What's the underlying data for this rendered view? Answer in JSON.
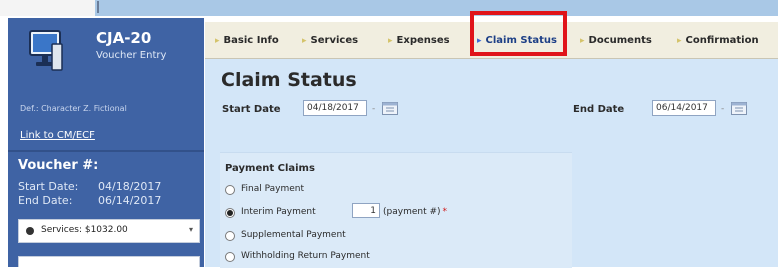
{
  "sidebar": {
    "app_title": "CJA-20",
    "app_subtitle": "Voucher Entry",
    "defendant": "Def.: Character Z. Fictional",
    "link_cm_ecf": "Link to CM/ECF",
    "voucher_label": "Voucher #:",
    "start_date_label": "Start Date:",
    "start_date": "04/18/2017",
    "end_date_label": "End Date:",
    "end_date": "06/14/2017",
    "services_label": "Services: $1032.00"
  },
  "tabs": [
    {
      "label": "Basic Info"
    },
    {
      "label": "Services"
    },
    {
      "label": "Expenses"
    },
    {
      "label": "Claim Status"
    },
    {
      "label": "Documents"
    },
    {
      "label": "Confirmation"
    }
  ],
  "active_tab": "Claim Status",
  "main": {
    "title": "Claim Status",
    "start_date_label": "Start Date",
    "start_date_value": "04/18/2017",
    "end_date_label": "End Date",
    "end_date_value": "06/14/2017",
    "payment_claims": {
      "title": "Payment Claims",
      "options": [
        {
          "label": "Final Payment",
          "selected": false
        },
        {
          "label": "Interim Payment",
          "selected": true
        },
        {
          "label": "Supplemental Payment",
          "selected": false
        },
        {
          "label": "Withholding Return Payment",
          "selected": false
        }
      ],
      "payment_number": "1",
      "payment_number_label": "(payment #)"
    }
  },
  "colors": {
    "sidebar_bg": "#3f63a4",
    "content_bg": "#d3e6f8",
    "highlight": "#e0141a",
    "tabbar_bg": "#f1eee0"
  }
}
